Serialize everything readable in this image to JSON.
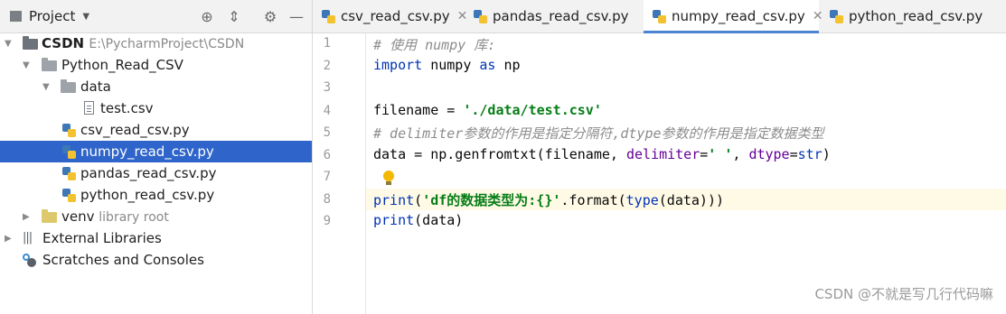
{
  "project_panel": {
    "title": "Project",
    "tree": [
      {
        "label": "CSDN",
        "extra": "E:\\PycharmProject\\CSDN"
      },
      {
        "label": "Python_Read_CSV"
      },
      {
        "label": "data"
      },
      {
        "label": "test.csv"
      },
      {
        "label": "csv_read_csv.py"
      },
      {
        "label": "numpy_read_csv.py"
      },
      {
        "label": "pandas_read_csv.py"
      },
      {
        "label": "python_read_csv.py"
      },
      {
        "label": "venv",
        "extra": "library root"
      },
      {
        "label": "External Libraries"
      },
      {
        "label": "Scratches and Consoles"
      }
    ]
  },
  "tabs": [
    {
      "label": "csv_read_csv.py"
    },
    {
      "label": "pandas_read_csv.py"
    },
    {
      "label": "numpy_read_csv.py",
      "active": true
    },
    {
      "label": "python_read_csv.py"
    }
  ],
  "editor": {
    "line_numbers": [
      "1",
      "2",
      "3",
      "4",
      "5",
      "6",
      "7",
      "8",
      "9"
    ],
    "lines": {
      "l1": "# 使用 numpy 库:",
      "l2_kw1": "import",
      "l2_mid": " numpy ",
      "l2_kw2": "as",
      "l2_end": " np",
      "l4_a": "filename = ",
      "l4_str": "'./data/test.csv'",
      "l5": "# delimiter参数的作用是指定分隔符,dtype参数的作用是指定数据类型",
      "l6_a": "data = np.genfromtxt(filename, ",
      "l6_p1": "delimiter",
      "l6_eq": "=",
      "l6_str": "' '",
      "l6_c": ", ",
      "l6_p2": "dtype",
      "l6_eq2": "=",
      "l6_kw": "str",
      "l6_end": ")",
      "l8_kw": "print",
      "l8_a": "(",
      "l8_str": "'df的数据类型为:{}'",
      "l8_b": ".format(",
      "l8_kw2": "type",
      "l8_c": "(data)))",
      "l9_kw": "print",
      "l9_a": "(data)"
    }
  },
  "watermark": "CSDN @不就是写几行代码嘛"
}
